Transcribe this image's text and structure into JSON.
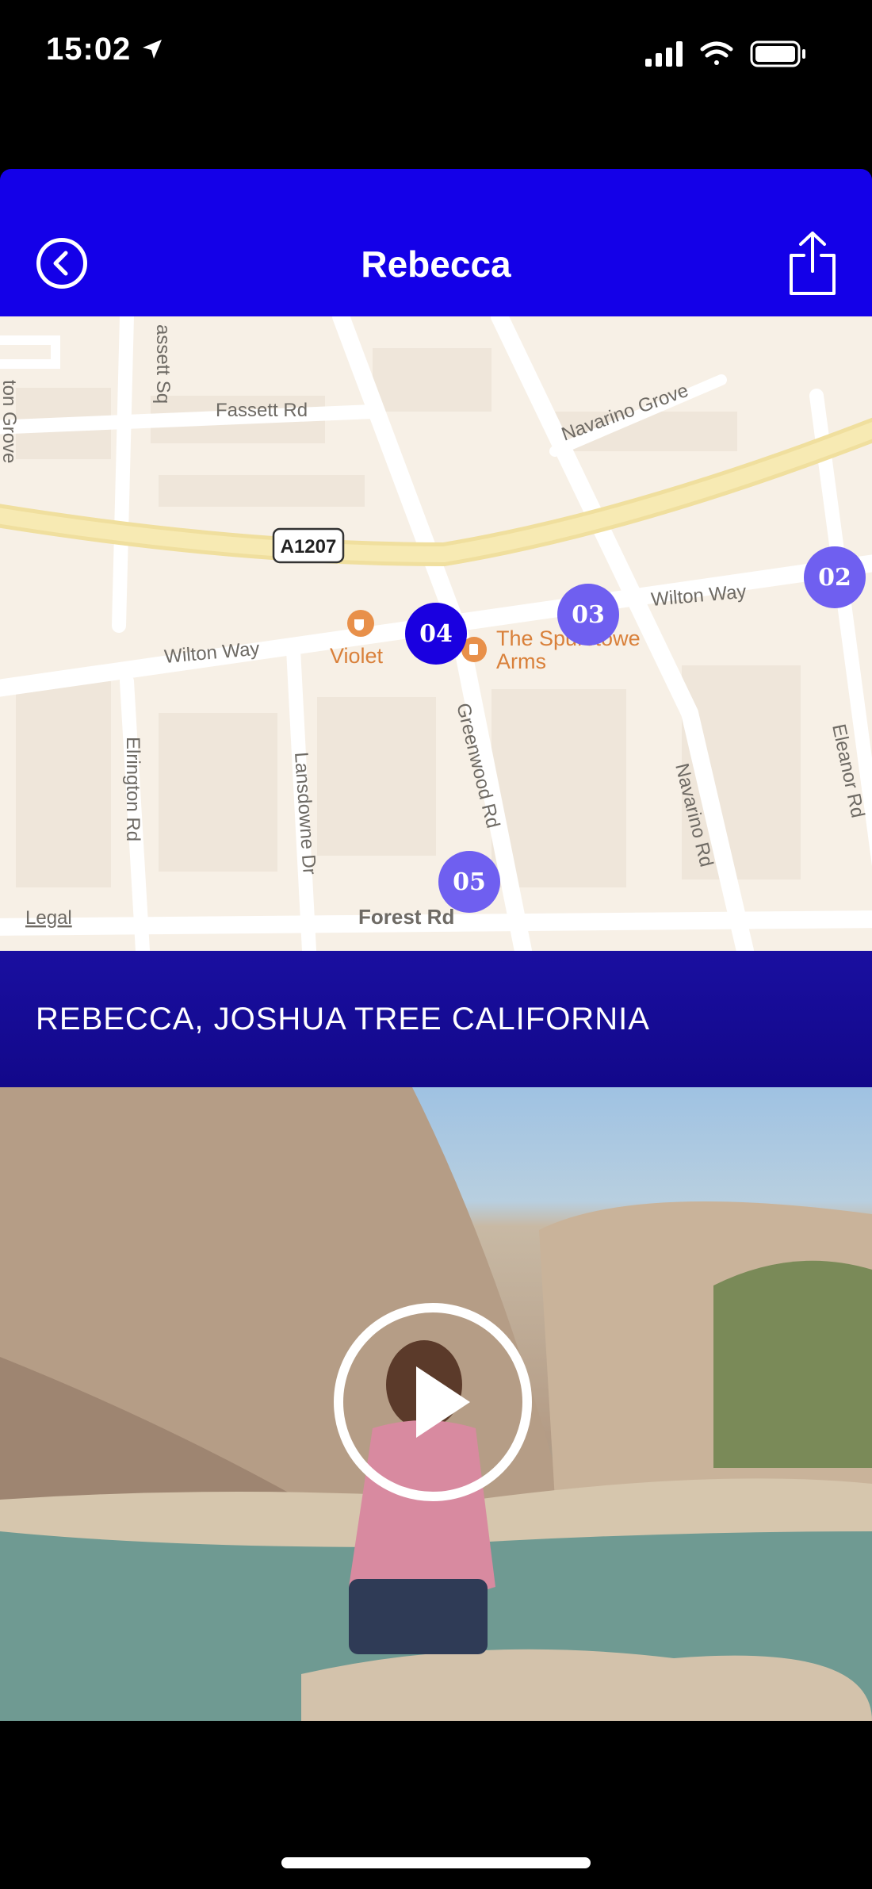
{
  "status_bar": {
    "time": "15:02"
  },
  "header": {
    "title": "Rebecca"
  },
  "map": {
    "streets": [
      "Fassett Rd",
      "assett Sq",
      "Navarino Grove",
      "Wilton Way",
      "Wilton Way",
      "Elrington Rd",
      "Lansdowne Dr",
      "Greenwood Rd",
      "Navarino Rd",
      "Eleanor Rd",
      "Forest Rd",
      "A1207",
      "ton Grove"
    ],
    "pois": {
      "violet": "Violet",
      "spurstowe_line1": "The Spurstowe",
      "spurstowe_line2": "Arms"
    },
    "legal": "Legal",
    "pins": [
      "02",
      "03",
      "04",
      "05"
    ],
    "active_pin": "04"
  },
  "caption": {
    "text": "REBECCA, JOSHUA TREE CALIFORNIA"
  },
  "video": {
    "play_icon": "play-icon"
  },
  "colors": {
    "brand_blue": "#1400e8",
    "pin": "#6f5ff0",
    "pin_active": "#1a00e0"
  }
}
